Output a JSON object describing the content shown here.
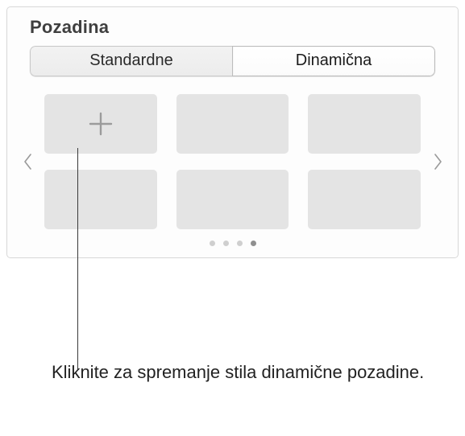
{
  "title": "Pozadina",
  "segments": {
    "standard": "Standardne",
    "dynamic": "Dinamična"
  },
  "tiles": {
    "add_label": "Add"
  },
  "pagination": {
    "count": 4,
    "active_index": 3
  },
  "callout": "Kliknite za spremanje stila dinamične pozadine."
}
